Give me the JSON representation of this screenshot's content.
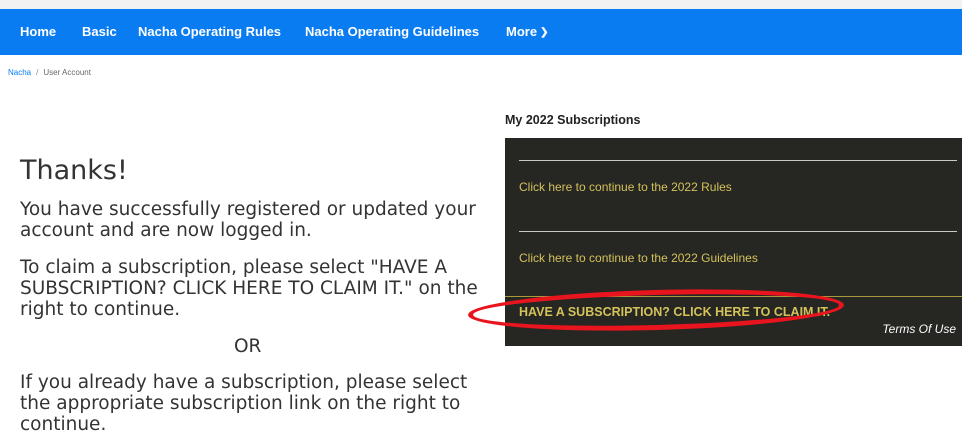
{
  "nav": {
    "items": [
      {
        "label": "Home"
      },
      {
        "label": "Basic"
      },
      {
        "label": "Nacha Operating Rules"
      },
      {
        "label": "Nacha Operating Guidelines"
      },
      {
        "label": "More"
      }
    ]
  },
  "breadcrumb": {
    "root": "Nacha",
    "separator": "/",
    "current": "User Account"
  },
  "main": {
    "title": "Thanks!",
    "message1": "You have successfully registered or updated your account and are now logged in.",
    "message2": "To claim a subscription, please select \"HAVE A SUBSCRIPTION? CLICK HERE TO CLAIM IT.\" on the right to continue.",
    "or": "OR",
    "message3": "If you already have a subscription, please select the appropriate subscription link on the right to continue."
  },
  "subscriptions": {
    "heading": "My 2022 Subscriptions",
    "links": [
      {
        "label": "Click here to continue to the 2022 Rules"
      },
      {
        "label": "Click here to continue to the 2022 Guidelines"
      }
    ],
    "claim_label": "HAVE A SUBSCRIPTION? CLICK HERE TO CLAIM IT.",
    "terms_label": "Terms Of Use"
  },
  "colors": {
    "nav_background": "#0a7cf2",
    "panel_background": "#262623",
    "panel_link": "#d4c25a",
    "annotation_circle": "#e8141e"
  },
  "icons": {
    "more_dropdown": "chevron-down-icon"
  }
}
